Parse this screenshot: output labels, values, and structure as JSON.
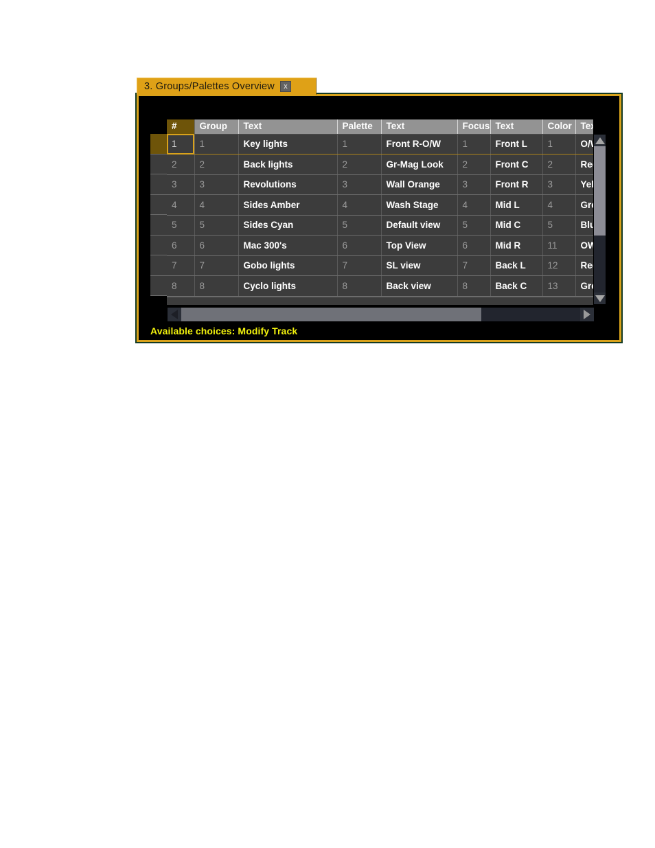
{
  "window": {
    "title": "3. Groups/Palettes Overview",
    "close_icon": "close-icon",
    "close_label": "x"
  },
  "colors": {
    "accent_amber": "#d9a21b",
    "title_bar": "#dfa117",
    "header_gray": "#939393",
    "row_gray": "#3c3c3c",
    "status_yellow": "#f2f20d",
    "selection_gold": "#6e5409",
    "outer_green": "#123a24"
  },
  "table": {
    "headers": [
      "#",
      "Group",
      "Text",
      "Palette",
      "Text",
      "Focus",
      "Text",
      "Color",
      "Text"
    ],
    "rows": [
      {
        "idx": "1",
        "group": "1",
        "group_text": "Key lights",
        "palette": "1",
        "palette_text": "Front R-O/W",
        "focus": "1",
        "focus_text": "Front L",
        "color": "1",
        "color_text": "O/W"
      },
      {
        "idx": "2",
        "group": "2",
        "group_text": "Back lights",
        "palette": "2",
        "palette_text": "Gr-Mag Look",
        "focus": "2",
        "focus_text": "Front C",
        "color": "2",
        "color_text": "Redi"
      },
      {
        "idx": "3",
        "group": "3",
        "group_text": "Revolutions",
        "palette": "3",
        "palette_text": "Wall Orange",
        "focus": "3",
        "focus_text": "Front R",
        "color": "3",
        "color_text": "Yello"
      },
      {
        "idx": "4",
        "group": "4",
        "group_text": "Sides Amber",
        "palette": "4",
        "palette_text": "Wash Stage",
        "focus": "4",
        "focus_text": "Mid L",
        "color": "4",
        "color_text": "Gree"
      },
      {
        "idx": "5",
        "group": "5",
        "group_text": "Sides Cyan",
        "palette": "5",
        "palette_text": "Default view",
        "focus": "5",
        "focus_text": "Mid C",
        "color": "5",
        "color_text": "Blue"
      },
      {
        "idx": "6",
        "group": "6",
        "group_text": "Mac 300's",
        "palette": "6",
        "palette_text": "Top View",
        "focus": "6",
        "focus_text": "Mid R",
        "color": "11",
        "color_text": "OW"
      },
      {
        "idx": "7",
        "group": "7",
        "group_text": "Gobo lights",
        "palette": "7",
        "palette_text": "SL view",
        "focus": "7",
        "focus_text": "Back L",
        "color": "12",
        "color_text": "Red"
      },
      {
        "idx": "8",
        "group": "8",
        "group_text": "Cyclo lights",
        "palette": "8",
        "palette_text": "Back view",
        "focus": "8",
        "focus_text": "Back C",
        "color": "13",
        "color_text": "Gree"
      }
    ],
    "selected_row_index": 0,
    "selected_column": "#"
  },
  "scrollbars": {
    "vertical": {
      "up_icon": "triangle-up-icon",
      "down_icon": "triangle-down-icon"
    },
    "horizontal": {
      "left_icon": "triangle-left-icon",
      "right_icon": "triangle-right-icon"
    }
  },
  "status": {
    "text": "Available choices: Modify Track"
  }
}
